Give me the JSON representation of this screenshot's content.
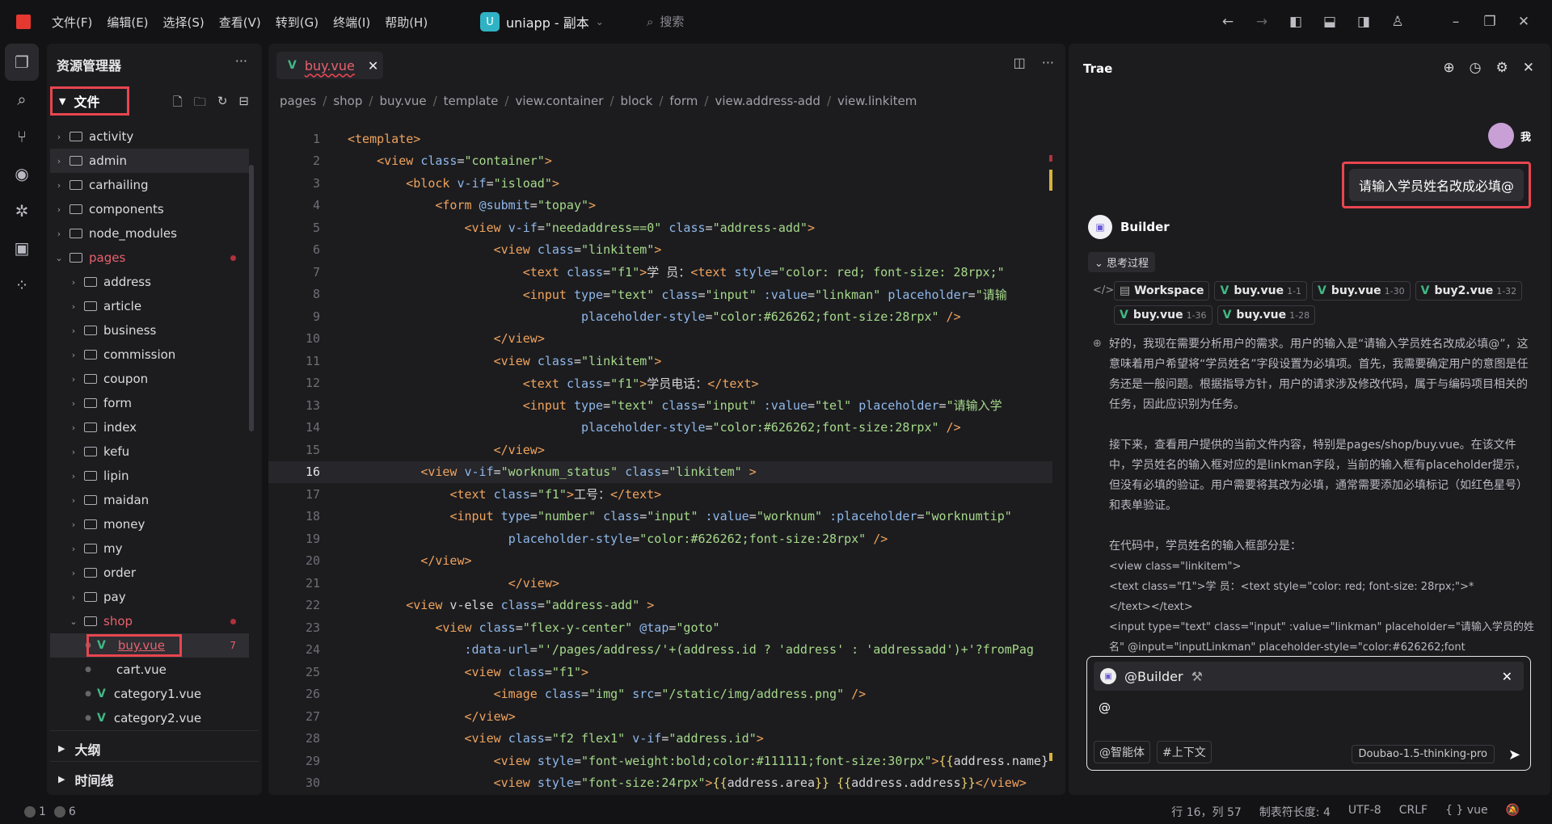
{
  "menu": [
    "文件(F)",
    "编辑(E)",
    "选择(S)",
    "查看(V)",
    "转到(G)",
    "终端(I)",
    "帮助(H)"
  ],
  "project": {
    "badge": "U",
    "name": "uniapp - 副本"
  },
  "search_placeholder": "搜索",
  "explorer": {
    "title": "资源管理器",
    "files_label": "文件",
    "tree": [
      {
        "name": "activity",
        "depth": 0,
        "open": false
      },
      {
        "name": "admin",
        "depth": 0,
        "open": false,
        "hl": true
      },
      {
        "name": "carhailing",
        "depth": 0,
        "open": false
      },
      {
        "name": "components",
        "depth": 0,
        "open": false
      },
      {
        "name": "node_modules",
        "depth": 0,
        "open": false
      },
      {
        "name": "pages",
        "depth": 0,
        "open": true,
        "red": true,
        "dot": true
      },
      {
        "name": "address",
        "depth": 1,
        "open": false
      },
      {
        "name": "article",
        "depth": 1,
        "open": false
      },
      {
        "name": "business",
        "depth": 1,
        "open": false
      },
      {
        "name": "commission",
        "depth": 1,
        "open": false
      },
      {
        "name": "coupon",
        "depth": 1,
        "open": false
      },
      {
        "name": "form",
        "depth": 1,
        "open": false
      },
      {
        "name": "index",
        "depth": 1,
        "open": false
      },
      {
        "name": "kefu",
        "depth": 1,
        "open": false
      },
      {
        "name": "lipin",
        "depth": 1,
        "open": false
      },
      {
        "name": "maidan",
        "depth": 1,
        "open": false
      },
      {
        "name": "money",
        "depth": 1,
        "open": false
      },
      {
        "name": "my",
        "depth": 1,
        "open": false
      },
      {
        "name": "order",
        "depth": 1,
        "open": false
      },
      {
        "name": "pay",
        "depth": 1,
        "open": false
      },
      {
        "name": "shop",
        "depth": 1,
        "open": true,
        "red": true,
        "dot": true
      },
      {
        "name": "buy.vue",
        "depth": 2,
        "file": "vue",
        "red": true,
        "selected": true,
        "badge": "7"
      },
      {
        "name": "cart.vue",
        "depth": 2,
        "file": "plain"
      },
      {
        "name": "category1.vue",
        "depth": 2,
        "file": "vue"
      },
      {
        "name": "category2.vue",
        "depth": 2,
        "file": "vue"
      }
    ],
    "outline": "大纲",
    "timeline": "时间线"
  },
  "editor": {
    "tab": "buy.vue",
    "crumbs": [
      "pages",
      "shop",
      "buy.vue",
      "template",
      "view.container",
      "block",
      "form",
      "view.address-add",
      "view.linkitem"
    ],
    "current_line": 16,
    "lines": [
      "<template>",
      "  <view class=\"container\">",
      "    <block v-if=\"isload\">",
      "      <form @submit=\"topay\">",
      "        <view v-if=\"needaddress==0\" class=\"address-add\">",
      "          <view class=\"linkitem\">",
      "            <text class=\"f1\">学 员：<text style=\"color: red; font-size: 28rpx;\"",
      "            <input type=\"text\" class=\"input\" :value=\"linkman\" placeholder=\"请输",
      "                placeholder-style=\"color:#626262;font-size:28rpx\" />",
      "          </view>",
      "          <view class=\"linkitem\">",
      "            <text class=\"f1\">学员电话：</text>",
      "            <input type=\"text\" class=\"input\" :value=\"tel\" placeholder=\"请输入学",
      "                placeholder-style=\"color:#626262;font-size:28rpx\" />",
      "          </view>",
      "     <view v-if=\"worknum_status\" class=\"linkitem\" >",
      "       <text class=\"f1\">工号：</text>",
      "       <input type=\"number\" class=\"input\" :value=\"worknum\" :placeholder=\"worknumtip\"",
      "           placeholder-style=\"color:#626262;font-size:28rpx\" />",
      "     </view>",
      "           </view>",
      "    <view v-else class=\"address-add\" >",
      "      <view class=\"flex-y-center\" @tap=\"goto\"",
      "        :data-url=\"'/pages/address/'+(address.id ? 'address' : 'addressadd')+'?fromPag",
      "        <view class=\"f1\">",
      "          <image class=\"img\" src=\"/static/img/address.png\" />",
      "        </view>",
      "        <view class=\"f2 flex1\" v-if=\"address.id\">",
      "          <view style=\"font-weight:bold;color:#111111;font-size:30rpx\">{{address.name}",
      "          <view style=\"font-size:24rpx\">{{address.area}} {{address.address}}</view>"
    ]
  },
  "chat": {
    "title": "Trae",
    "me": "我",
    "user_message": "请输入学员姓名改成必填@",
    "builder": "Builder",
    "thinking": "思考过程",
    "chips": [
      {
        "label": "Workspace",
        "range": ""
      },
      {
        "label": "buy.vue",
        "range": "1-1"
      },
      {
        "label": "buy.vue",
        "range": "1-30"
      },
      {
        "label": "buy2.vue",
        "range": "1-32"
      },
      {
        "label": "buy.vue",
        "range": "1-36"
      },
      {
        "label": "buy.vue",
        "range": "1-28"
      }
    ],
    "answer": [
      "好的，我现在需要分析用户的需求。用户的输入是“请输入学员姓名改成必填@”，这意味着用户希望将“学员姓名”字段设置为必填项。首先，我需要确定用户的意图是任务还是一般问题。根据指导方针，用户的请求涉及修改代码，属于与编码项目相关的任务，因此应识别为任务。",
      "接下来，查看用户提供的当前文件内容，特别是pages/shop/buy.vue。在该文件中，学员姓名的输入框对应的是linkman字段，当前的输入框有placeholder提示，但没有必填的验证。用户需要将其改为必填，通常需要添加必填标记（如红色星号）和表单验证。",
      "在代码中，学员姓名的输入框部分是："
    ],
    "answer_code": [
      "<view class=\"linkitem\">",
      "  <text class=\"f1\">学 员：<text style=\"color: red; font-size: 28rpx;\">*",
      "</text></text>",
      "  <input type=\"text\" class=\"input\" :value=\"linkman\" placeholder=\"请输入学员的姓名\" @input=\"inputLinkman\" placeholder-style=\"color:#626262;font"
    ],
    "input_target": "@Builder",
    "input_text": "@",
    "btn_agent": "@智能体",
    "btn_context": "#上下文",
    "model": "Doubao-1.5-thinking-pro"
  },
  "status": {
    "errors": "1",
    "warnings": "6",
    "position": "行 16，列 57",
    "tab_size": "制表符长度: 4",
    "encoding": "UTF-8",
    "eol": "CRLF",
    "language": "vue"
  }
}
